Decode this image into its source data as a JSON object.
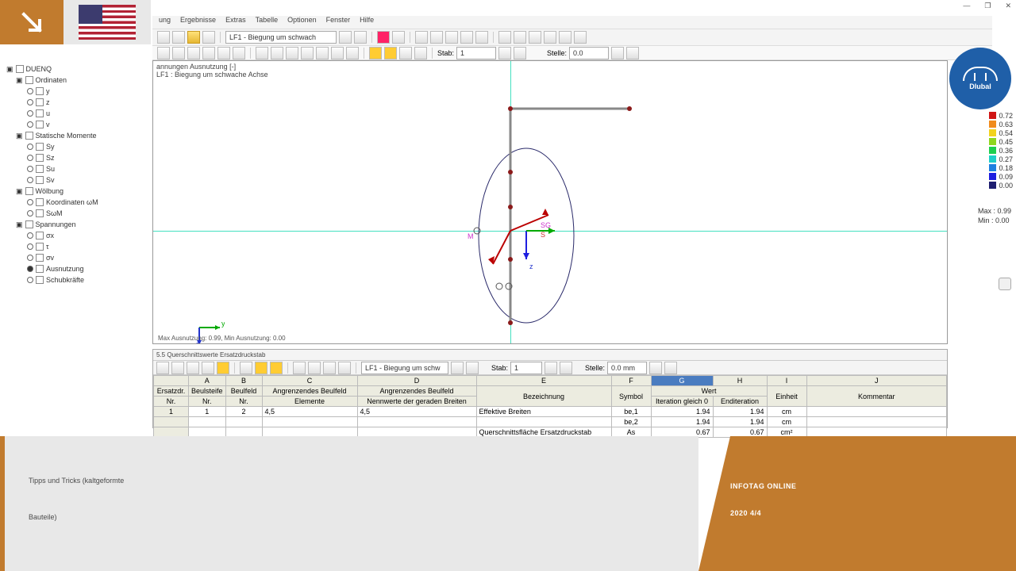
{
  "menu": [
    "ung",
    "Ergebnisse",
    "Extras",
    "Tabelle",
    "Optionen",
    "Fenster",
    "Hilfe"
  ],
  "toolbar_select": "LF1 - Biegung um schwach",
  "toolbar_stab_label": "Stab:",
  "toolbar_stab_val": "1",
  "toolbar_stelle_label": "Stelle:",
  "toolbar_stelle_val": "0.0",
  "tree": {
    "root": "DUENQ",
    "groups": [
      {
        "label": "Ordinaten",
        "items": [
          "y",
          "z",
          "u",
          "v"
        ]
      },
      {
        "label": "Statische Momente",
        "items": [
          "Sy",
          "Sz",
          "Su",
          "Sv"
        ]
      },
      {
        "label": "Wölbung",
        "items": [
          "Koordinaten ωM",
          "SωM"
        ]
      },
      {
        "label": "Spannungen",
        "items": [
          "σx",
          "τ",
          "σv",
          "Ausnutzung",
          "Schubkräfte"
        ],
        "selected": 3
      }
    ]
  },
  "canvas": {
    "title1": "annungen Ausnutzung [-]",
    "title2": "LF1 : Biegung um schwache Achse",
    "footer": "Max Ausnutzung: 0.99, Min Ausnutzung: 0.00",
    "labels": {
      "m": "M",
      "sg": "SG",
      "s": "S",
      "z": "z"
    }
  },
  "legend": [
    {
      "c": "#d01515",
      "v": "0.72"
    },
    {
      "c": "#f08b1c",
      "v": "0.63"
    },
    {
      "c": "#f2d21e",
      "v": "0.54"
    },
    {
      "c": "#8fd61e",
      "v": "0.45"
    },
    {
      "c": "#1ecf4e",
      "v": "0.36"
    },
    {
      "c": "#1ecfc8",
      "v": "0.27"
    },
    {
      "c": "#1e80e0",
      "v": "0.18"
    },
    {
      "c": "#1e1ee0",
      "v": "0.09"
    },
    {
      "c": "#1e1e70",
      "v": "0.00"
    }
  ],
  "maxmin": {
    "max": "Max : 0.99",
    "min": "Min  : 0.00"
  },
  "dlubal": "Dlubal",
  "table": {
    "title": "5.5 Querschnittswerte Ersatzdruckstab",
    "tb_select": "LF1 - Biegung um schw",
    "tb_stab": "Stab:",
    "tb_stab_v": "1",
    "tb_stelle": "Stelle:",
    "tb_stelle_v": "0.0 mm",
    "cols": [
      "",
      "A",
      "B",
      "C",
      "D",
      "E",
      "F",
      "G",
      "H",
      "I",
      "J"
    ],
    "h1": [
      "Ersatzdr.",
      "Beulsteife",
      "Beulfeld",
      "Angrenzendes Beulfeld",
      "Angrenzendes Beulfeld",
      "",
      "",
      "Wert",
      "",
      "",
      ""
    ],
    "h2": [
      "Nr.",
      "Nr.",
      "Nr.",
      "Elemente",
      "Nennwerte der geraden Breiten",
      "Bezeichnung",
      "Symbol",
      "Iteration gleich 0",
      "Enditeration",
      "Einheit",
      "Kommentar"
    ],
    "rows": [
      [
        "1",
        "1",
        "2",
        "4,5",
        "4,5",
        "Effektive Breiten",
        "be,1",
        "1.94",
        "1.94",
        "cm",
        ""
      ],
      [
        "",
        "",
        "",
        "",
        "",
        "",
        "be,2",
        "1.94",
        "1.94",
        "cm",
        ""
      ],
      [
        "",
        "",
        "",
        "",
        "",
        "Querschnittsfläche Ersatzdruckstab",
        "As",
        "0.67",
        "0.67",
        "cm²",
        ""
      ]
    ]
  },
  "banner": {
    "left_l1": "Tipps und Tricks (kaltgeformte",
    "left_l2": "Bauteile)",
    "right_l1": "INFOTAG ONLINE",
    "right_l2": "2020 4/4"
  },
  "win": [
    "—",
    "❐",
    "✕"
  ]
}
